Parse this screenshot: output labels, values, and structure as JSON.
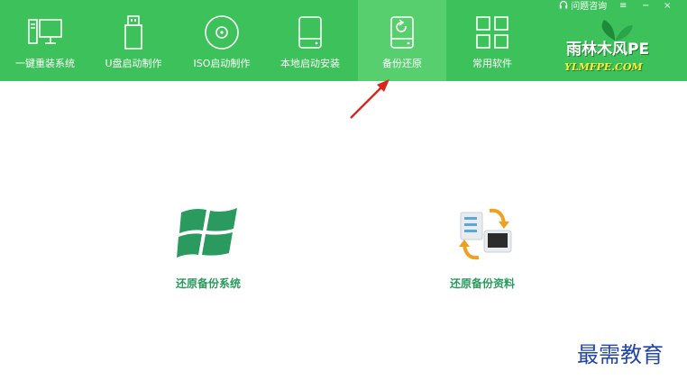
{
  "window": {
    "help_label": "问题咨询",
    "menu_glyph": "≡",
    "minimize_glyph": "−",
    "close_glyph": "×"
  },
  "nav": {
    "items": [
      {
        "label": "一键重装系统",
        "icon": "computer-icon"
      },
      {
        "label": "U盘启动制作",
        "icon": "usb-drive-icon"
      },
      {
        "label": "ISO启动制作",
        "icon": "disc-icon"
      },
      {
        "label": "本地启动安装",
        "icon": "hard-drive-icon"
      },
      {
        "label": "备份还原",
        "icon": "backup-restore-icon"
      },
      {
        "label": "常用软件",
        "icon": "app-grid-icon"
      }
    ],
    "active_index": 4
  },
  "logo": {
    "line1": "雨林木风PE",
    "line2": "YLMFPE.COM"
  },
  "actions": [
    {
      "label": "还原备份系统",
      "icon": "windows-logo-icon"
    },
    {
      "label": "还原备份资料",
      "icon": "file-transfer-icon"
    }
  ],
  "watermark": "最需教育",
  "colors": {
    "brand_green": "#3dc15a",
    "active_tab": "#58cf6f",
    "action_text": "#2a9a5e",
    "arrow": "#d9261c"
  }
}
